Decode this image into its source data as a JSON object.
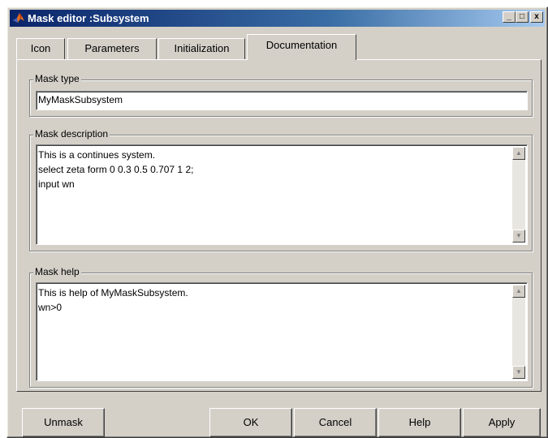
{
  "window": {
    "title": "Mask editor :Subsystem",
    "controls": {
      "minimize": "_",
      "maximize": "□",
      "close": "x"
    }
  },
  "tabs": [
    {
      "label": "Icon"
    },
    {
      "label": "Parameters"
    },
    {
      "label": "Initialization"
    },
    {
      "label": "Documentation"
    }
  ],
  "active_tab": "Documentation",
  "mask_type": {
    "label": "Mask type",
    "value": "MyMaskSubsystem"
  },
  "mask_description": {
    "label": "Mask description",
    "lines": [
      "This is a continues system.",
      "select zeta form 0 0.3 0.5 0.707 1 2;",
      "input wn"
    ]
  },
  "mask_help": {
    "label": "Mask help",
    "lines": [
      "This is help of MyMaskSubsystem.",
      "wn>0"
    ]
  },
  "buttons": {
    "unmask": "Unmask",
    "ok": "OK",
    "cancel": "Cancel",
    "help": "Help",
    "apply": "Apply"
  },
  "icons": {
    "app": "matlab-logo-icon",
    "scroll_up": "▲",
    "scroll_down": "▼"
  },
  "colors": {
    "titlebar_start": "#0a246a",
    "titlebar_end": "#a6caf0",
    "face": "#d4d0c8"
  }
}
